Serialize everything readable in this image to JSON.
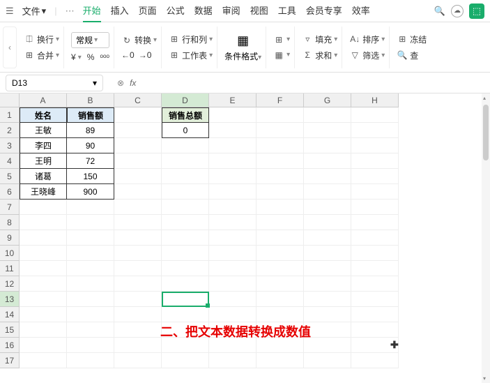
{
  "menubar": {
    "file_label": "文件",
    "tabs": [
      "开始",
      "插入",
      "页面",
      "公式",
      "数据",
      "审阅",
      "视图",
      "工具",
      "会员专享",
      "效率"
    ],
    "active_tab": 0
  },
  "ribbon": {
    "wrap": "换行",
    "merge": "合并",
    "num_format": "常规",
    "convert": "转换",
    "rowcol": "行和列",
    "worksheet": "工作表",
    "cond_format": "条件格式",
    "fill": "填充",
    "sum": "求和",
    "sort": "排序",
    "filter": "筛选",
    "freeze": "冻结",
    "find": "查"
  },
  "namebox": {
    "ref": "D13"
  },
  "columns": [
    "A",
    "B",
    "C",
    "D",
    "E",
    "F",
    "G",
    "H"
  ],
  "rows": [
    1,
    2,
    3,
    4,
    5,
    6,
    7,
    8,
    9,
    10,
    11,
    12,
    13,
    14,
    15,
    16,
    17
  ],
  "headers": {
    "a": "姓名",
    "b": "销售额",
    "d": "销售总额"
  },
  "data": {
    "names": [
      "王敏",
      "李四",
      "王明",
      "诸葛",
      "王晓峰"
    ],
    "sales": [
      "89",
      "90",
      "72",
      "150",
      "900"
    ],
    "total": "0"
  },
  "annotation": "二、把文本数据转换成数值",
  "selected_col": 3,
  "selected_row": 12
}
